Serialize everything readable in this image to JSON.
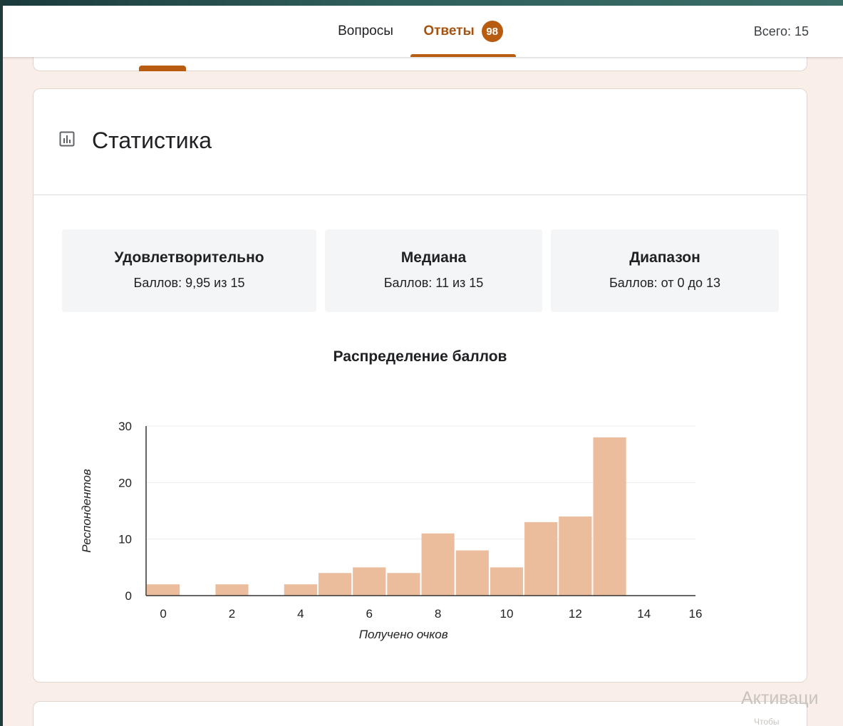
{
  "header": {
    "tabs": [
      {
        "label": "Вопросы",
        "active": false
      },
      {
        "label": "Ответы",
        "active": true,
        "badge": "98"
      }
    ],
    "total_label": "Всего: 15"
  },
  "statistics": {
    "title": "Статистика",
    "icon": "bar-chart-icon",
    "metrics": [
      {
        "label": "Удовлетворительно",
        "value": "Баллов: 9,95 из 15"
      },
      {
        "label": "Медиана",
        "value": "Баллов: 11 из 15"
      },
      {
        "label": "Диапазон",
        "value": "Баллов: от 0 до 13"
      }
    ]
  },
  "chart_data": {
    "type": "bar",
    "title": "Распределение баллов",
    "xlabel": "Получено очков",
    "ylabel": "Респондентов",
    "categories": [
      0,
      1,
      2,
      3,
      4,
      5,
      6,
      7,
      8,
      9,
      10,
      11,
      12,
      13,
      14,
      15
    ],
    "values": [
      2,
      0,
      2,
      0,
      2,
      4,
      5,
      4,
      11,
      8,
      5,
      13,
      14,
      28,
      0,
      0
    ],
    "xticks": [
      0,
      2,
      4,
      6,
      8,
      10,
      12,
      14,
      16
    ],
    "yticks": [
      0,
      10,
      20,
      30
    ],
    "xlim": [
      0,
      16
    ],
    "ylim": [
      0,
      30
    ],
    "bar_color": "#ebbd9d",
    "grid": true
  },
  "watermark": {
    "text": "Активаци",
    "subtext": "Чтобы"
  },
  "colors": {
    "accent": "#b85c12",
    "page_background": "#f9efe8",
    "bar": "#ebbd9d"
  }
}
